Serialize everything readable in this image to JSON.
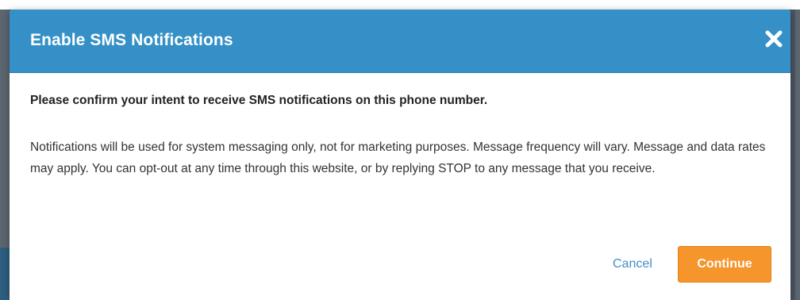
{
  "modal": {
    "title": "Enable SMS Notifications",
    "confirm_text": "Please confirm your intent to receive SMS notifications on this phone number.",
    "info_text": "Notifications will be used for system messaging only, not for marketing purposes. Message frequency will vary. Message and data rates may apply. You can opt-out at any time through this website, or by replying STOP to any message that you receive.",
    "cancel_label": "Cancel",
    "continue_label": "Continue",
    "close_icon": "close-icon"
  },
  "colors": {
    "header_bg": "#3490c6",
    "continue_bg": "#f5952c",
    "cancel_link": "#3f8fc6"
  }
}
